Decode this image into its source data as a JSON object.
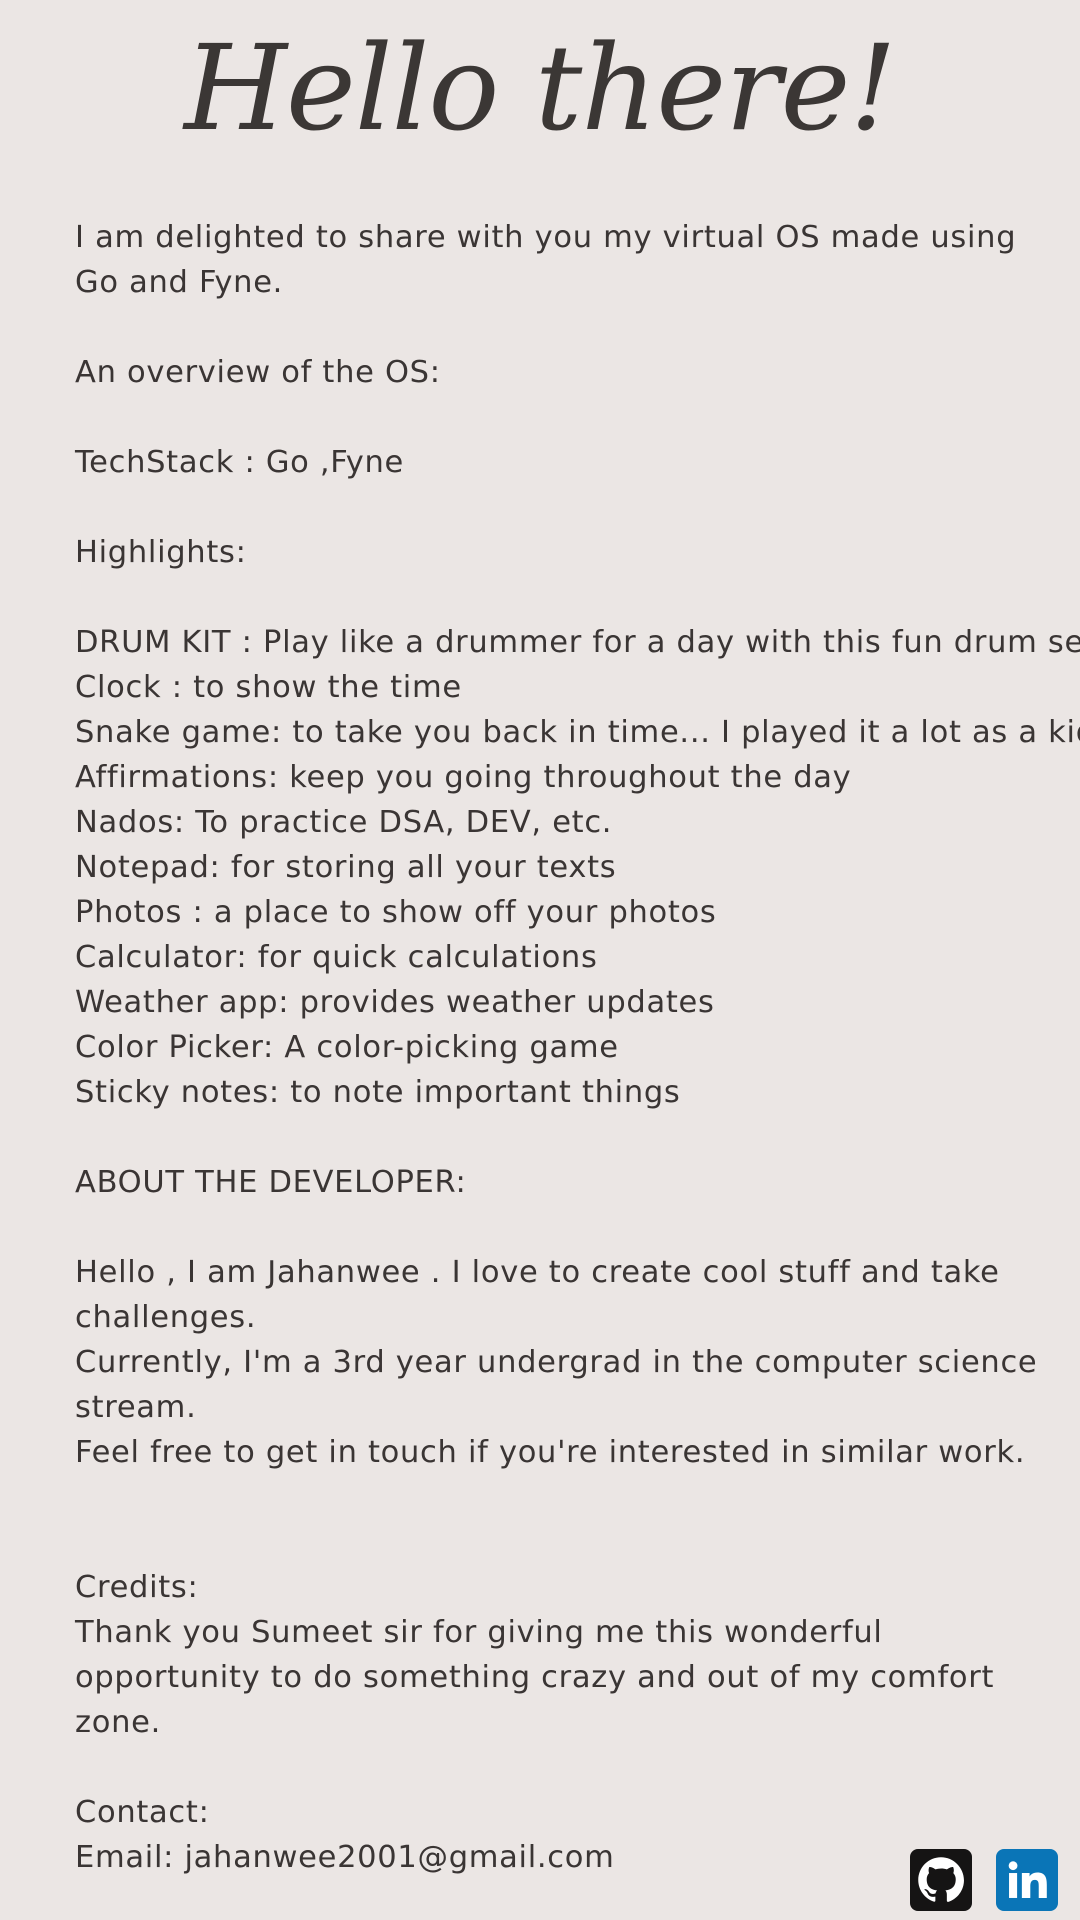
{
  "header": {
    "title": "Hello there!"
  },
  "intro": {
    "text": "I am delighted to share with you my virtual OS made using Go and Fyne."
  },
  "overview": {
    "heading": "An overview of the OS:",
    "techstack": "TechStack : Go ,Fyne",
    "highlights_heading": "Highlights:",
    "highlights": [
      "DRUM KIT : Play like a drummer for a day with this fun drum set.",
      "Clock : to show the time",
      "Snake game: to take you back in time... I played it a lot as a kid",
      "Affirmations: keep you going throughout the day",
      "Nados: To practice DSA, DEV, etc.",
      "Notepad: for storing all your texts",
      "Photos : a place to show off your photos",
      "Calculator: for quick calculations",
      "Weather app: provides weather updates",
      "Color Picker: A color-picking game",
      "Sticky notes: to note important things"
    ]
  },
  "about": {
    "heading": "ABOUT THE DEVELOPER:",
    "paragraphs": [
      "Hello , I am Jahanwee . I love to create cool stuff and take challenges.",
      "Currently, I'm a 3rd year undergrad in the computer science stream.",
      "Feel free to get in touch if you're interested in similar work."
    ]
  },
  "credits": {
    "heading": "Credits:",
    "text": "Thank you Sumeet sir for giving me this wonderful opportunity to do something crazy and out of my comfort zone."
  },
  "contact": {
    "heading": "Contact:",
    "email": "Email: jahanwee2001@gmail.com"
  },
  "social": {
    "github_icon": "github-icon",
    "linkedin_icon": "linkedin-icon",
    "github_color": "#151414",
    "linkedin_color": "#0a75b7",
    "linkedin_glyph": "in"
  },
  "colors": {
    "background": "#ebe6e4",
    "text": "#3a3534"
  }
}
